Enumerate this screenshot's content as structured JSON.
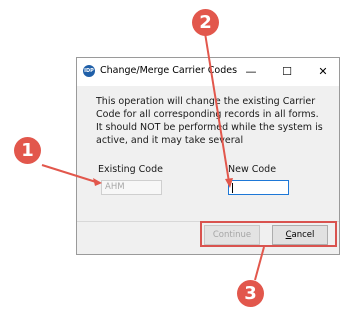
{
  "dialog": {
    "title": "Change/Merge Carrier Codes",
    "icon_text": "IDP",
    "minimize_glyph": "—",
    "maximize_glyph": "☐",
    "close_glyph": "✕",
    "message": "This operation will change the existing Carrier Code for all corresponding records in all forms. It should NOT be performed while the system is active, and it may take several",
    "existing_code_label": "Existing Code",
    "existing_code_value": "AHM",
    "new_code_label": "New Code",
    "new_code_value": "",
    "continue_label": "Continue",
    "cancel_label_first": "C",
    "cancel_label_rest": "ancel"
  },
  "callouts": {
    "one": "1",
    "two": "2",
    "three": "3"
  },
  "colors": {
    "callout": "#e2574c",
    "highlight": "#d9534f",
    "focus_border": "#1e78d7"
  }
}
